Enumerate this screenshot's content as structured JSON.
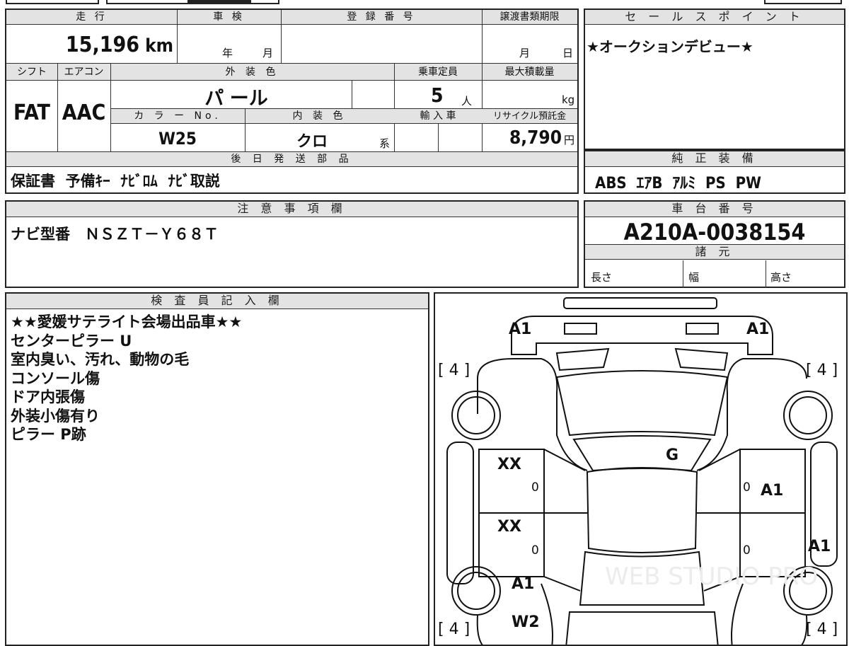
{
  "top_strip": {
    "partial_text": ""
  },
  "mileage": {
    "label": "走 行",
    "value": "15,196",
    "unit": "km"
  },
  "inspection": {
    "label": "車 検",
    "year_unit": "年",
    "month_unit": "月"
  },
  "registration": {
    "label": "登 録 番 号",
    "value": ""
  },
  "transfer": {
    "label": "譲渡書類期限",
    "month_unit": "月",
    "day_unit": "日"
  },
  "sales_point": {
    "label": "セ ー ル ス ポ イ ン ト",
    "text": "★オークションデビュー★"
  },
  "shift": {
    "label": "シフト",
    "value": "FAT"
  },
  "aircon": {
    "label": "エアコン",
    "value": "AAC"
  },
  "exterior": {
    "label": "外 装 色",
    "value": "パ ール"
  },
  "capacity": {
    "label": "乗車定員",
    "value": "5",
    "unit": "人"
  },
  "max_load": {
    "label": "最大積載量",
    "unit": "kg"
  },
  "color_no": {
    "label": "カ ラ ー No.",
    "value": "W25"
  },
  "interior": {
    "label": "内 装 色",
    "value": "クロ",
    "suffix": "系"
  },
  "import": {
    "label": "輸 入 車"
  },
  "recycle": {
    "label": "リサイクル預託金",
    "value": "8,790",
    "unit": "円"
  },
  "later_parts": {
    "label": "後 日 発 送 部 品",
    "text": "保証書  予備ｷｰ  ﾅﾋﾞﾛﾑ  ﾅﾋﾞ取説"
  },
  "genuine": {
    "label": "純 正 装 備",
    "text": "ABS  ｴｱB  ｱﾙﾐ  PS  PW"
  },
  "notes": {
    "label": "注 意 事 項 欄",
    "text": "ナビ型番　ＮＳＺＴ－Ｙ６８Ｔ"
  },
  "chassis": {
    "label": "車 台 番 号",
    "value": "A210A-0038154"
  },
  "specs": {
    "label": "諸 元",
    "length": "長さ",
    "width": "幅",
    "height": "高さ"
  },
  "inspector": {
    "label": "検 査 員 記 入 欄",
    "lines": [
      "★★愛媛サテライト会場出品車★★",
      "センターピラー U",
      "室内臭い、汚れ、動物の毛",
      "コンソール傷",
      "ドア内張傷",
      "外装小傷有り",
      "ピラー P跡"
    ]
  },
  "diagram": {
    "marks": {
      "front_left": "A1",
      "front_right": "A1",
      "tire_fl": "[ 4 ]",
      "tire_fr": "[ 4 ]",
      "tire_rl": "[ 4 ]",
      "tire_rr": "[ 4 ]",
      "door_fl": "XX",
      "door_fl_zero": "0",
      "door_rl": "XX",
      "door_rl_zero": "0",
      "door_fr_zero": "0",
      "door_fr": "A1",
      "door_rr_zero": "0",
      "side_r": "A1",
      "roof": "G",
      "rear_l_a": "A1",
      "rear_l_w": "W2"
    },
    "watermark": "WEB STUDIO PRO"
  }
}
